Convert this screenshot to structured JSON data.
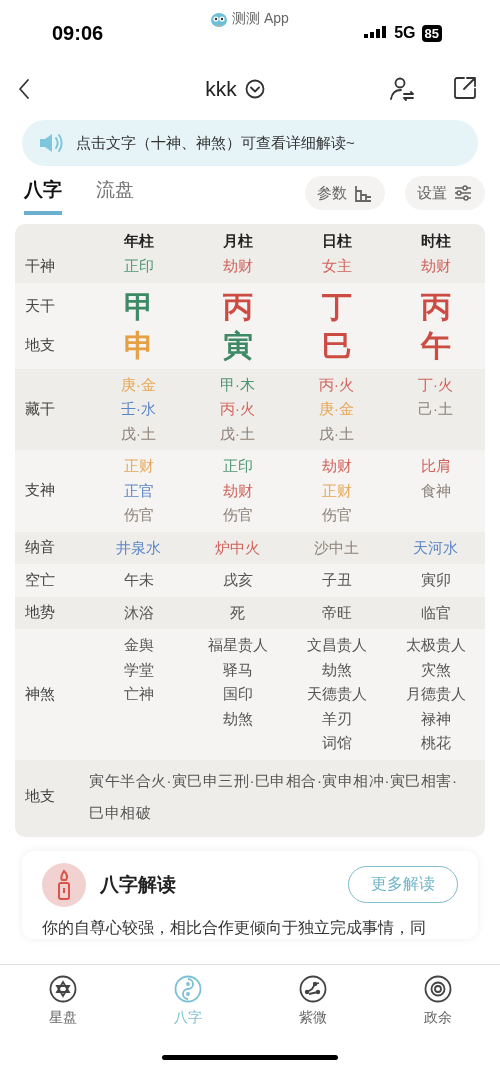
{
  "status_bar": {
    "time": "09:06",
    "app": "测测 App",
    "network": "5G",
    "battery": "85"
  },
  "header": {
    "title": "kkk"
  },
  "notice": {
    "text": "点击文字（十神、神煞）可查看详细解读~"
  },
  "tabs": [
    {
      "label": "八字",
      "selected": true
    },
    {
      "label": "流盘",
      "selected": false
    }
  ],
  "tool_buttons": [
    {
      "label": "参数",
      "kind": "params"
    },
    {
      "label": "设置",
      "kind": "settings"
    }
  ],
  "table": {
    "columns": [
      "年柱",
      "月柱",
      "日柱",
      "时柱"
    ],
    "sections": [
      {
        "rows": [
          {
            "label": "干神",
            "kind": "single",
            "cells": [
              {
                "text": "正印",
                "color": "#4e9676"
              },
              {
                "text": "劫财",
                "color": "#d0625a"
              },
              {
                "text": "女主",
                "color": "#d0625a"
              },
              {
                "text": "劫财",
                "color": "#d0625a"
              }
            ]
          }
        ]
      },
      {
        "rows": [
          {
            "label": "天干",
            "kind": "big",
            "cells": [
              {
                "text": "甲",
                "color": "#3f8a66"
              },
              {
                "text": "丙",
                "color": "#cc4b42"
              },
              {
                "text": "丁",
                "color": "#cc4b42"
              },
              {
                "text": "丙",
                "color": "#cc4b42"
              }
            ]
          },
          {
            "label": "地支",
            "kind": "big",
            "cells": [
              {
                "text": "申",
                "color": "#e5a043"
              },
              {
                "text": "寅",
                "color": "#3f8a66"
              },
              {
                "text": "巳",
                "color": "#cc4b42"
              },
              {
                "text": "午",
                "color": "#cc4b42"
              }
            ]
          }
        ]
      },
      {
        "rows": [
          {
            "label": "藏干",
            "kind": "stack",
            "cells": [
              [
                {
                  "text": "庚·金",
                  "color": "#e5a756"
                },
                {
                  "text": "壬·水",
                  "color": "#5b86c6"
                },
                {
                  "text": "戊·土",
                  "color": "#8c8178"
                }
              ],
              [
                {
                  "text": "甲·木",
                  "color": "#4e9676"
                },
                {
                  "text": "丙·火",
                  "color": "#d0625a"
                },
                {
                  "text": "戊·土",
                  "color": "#8c8178"
                }
              ],
              [
                {
                  "text": "丙·火",
                  "color": "#d0625a"
                },
                {
                  "text": "庚·金",
                  "color": "#e5a756"
                },
                {
                  "text": "戊·土",
                  "color": "#8c8178"
                }
              ],
              [
                {
                  "text": "丁·火",
                  "color": "#d0625a"
                },
                {
                  "text": "己·土",
                  "color": "#8c8178"
                }
              ]
            ]
          }
        ]
      },
      {
        "rows": [
          {
            "label": "支神",
            "kind": "stack",
            "cells": [
              [
                {
                  "text": "正财",
                  "color": "#e5a756"
                },
                {
                  "text": "正官",
                  "color": "#5b86c6"
                },
                {
                  "text": "伤官",
                  "color": "#8c8178"
                }
              ],
              [
                {
                  "text": "正印",
                  "color": "#4e9676"
                },
                {
                  "text": "劫财",
                  "color": "#d0625a"
                },
                {
                  "text": "伤官",
                  "color": "#8c8178"
                }
              ],
              [
                {
                  "text": "劫财",
                  "color": "#d0625a"
                },
                {
                  "text": "正财",
                  "color": "#e5a756"
                },
                {
                  "text": "伤官",
                  "color": "#8c8178"
                }
              ],
              [
                {
                  "text": "比肩",
                  "color": "#d0625a"
                },
                {
                  "text": "食神",
                  "color": "#8c8178"
                }
              ]
            ]
          }
        ]
      },
      {
        "rows": [
          {
            "label": "纳音",
            "kind": "single",
            "cells": [
              {
                "text": "井泉水",
                "color": "#5b86c6"
              },
              {
                "text": "炉中火",
                "color": "#d0625a"
              },
              {
                "text": "沙中土",
                "color": "#8c8178"
              },
              {
                "text": "天河水",
                "color": "#5b86c6"
              }
            ]
          }
        ]
      },
      {
        "rows": [
          {
            "label": "空亡",
            "kind": "single",
            "cells": [
              {
                "text": "午未"
              },
              {
                "text": "戌亥"
              },
              {
                "text": "子丑"
              },
              {
                "text": "寅卯"
              }
            ]
          }
        ]
      },
      {
        "rows": [
          {
            "label": "地势",
            "kind": "single",
            "cells": [
              {
                "text": "沐浴"
              },
              {
                "text": "死"
              },
              {
                "text": "帝旺"
              },
              {
                "text": "临官"
              }
            ]
          }
        ]
      },
      {
        "rows": [
          {
            "label": "神煞",
            "kind": "stack",
            "cells": [
              [
                {
                  "text": "金舆"
                },
                {
                  "text": "学堂"
                },
                {
                  "text": "亡神"
                }
              ],
              [
                {
                  "text": "福星贵人"
                },
                {
                  "text": "驿马"
                },
                {
                  "text": "国印"
                },
                {
                  "text": "劫煞"
                }
              ],
              [
                {
                  "text": "文昌贵人"
                },
                {
                  "text": "劫煞"
                },
                {
                  "text": "天德贵人"
                },
                {
                  "text": "羊刃"
                },
                {
                  "text": "词馆"
                }
              ],
              [
                {
                  "text": "太极贵人"
                },
                {
                  "text": "灾煞"
                },
                {
                  "text": "月德贵人"
                },
                {
                  "text": "禄神"
                },
                {
                  "text": "桃花"
                }
              ]
            ]
          }
        ]
      },
      {
        "rows": [
          {
            "label": "地支",
            "kind": "relation",
            "text": "寅午半合火·寅巳申三刑·巳申相合·寅申相冲·寅巳相害·巳申相破"
          }
        ]
      }
    ]
  },
  "reading": {
    "title": "八字解读",
    "button": "更多解读",
    "text": "你的自尊心较强，相比合作更倾向于独立完成事情，同"
  },
  "bottom_nav": [
    {
      "label": "星盘",
      "kind": "star",
      "selected": false
    },
    {
      "label": "八字",
      "kind": "yinyang",
      "selected": true
    },
    {
      "label": "紫微",
      "kind": "constellation",
      "selected": false
    },
    {
      "label": "政余",
      "kind": "rings",
      "selected": false
    }
  ]
}
